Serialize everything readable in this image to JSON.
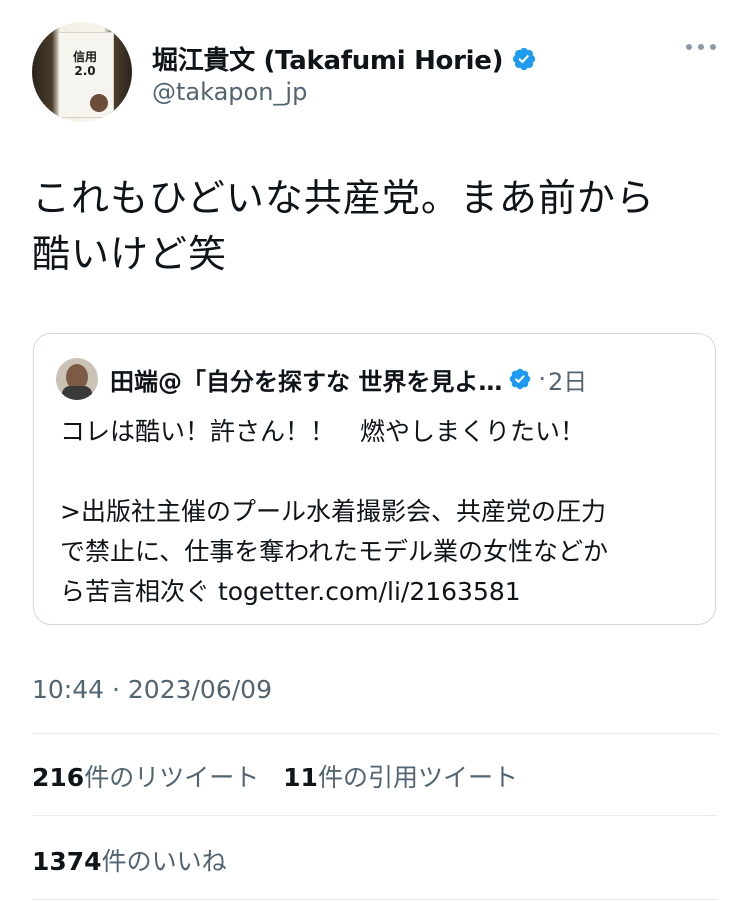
{
  "author": {
    "display_name": "堀江貴文 (Takafumi Horie)",
    "handle": "@takapon_jp",
    "avatar_book_title": "信用\n2.0"
  },
  "tweet": {
    "text": "これもひどいな共産党。まあ前から\n酷いけど笑"
  },
  "quoted_tweet": {
    "author_name": "田端@「自分を探すな 世界を見よ…",
    "separator": "·",
    "time": "2日",
    "text": "コレは酷い！許さん！！　燃やしまくりたい！\n\n>出版社主催のプール水着撮影会、共産党の圧力\nで禁止に、仕事を奪われたモデル業の女性などか\nら苦言相次ぐ togetter.com/li/2163581"
  },
  "meta": {
    "timestamp": "10:44 · 2023/06/09"
  },
  "stats": {
    "retweets_count": "216",
    "retweets_label": "件のリツイート",
    "quotes_count": "11",
    "quotes_label": "件の引用ツイート",
    "likes_count": "1374",
    "likes_label": "件のいいね"
  },
  "colors": {
    "verified_blue": "#1d9bf0",
    "secondary_text": "#536471",
    "border": "#cfd9de"
  },
  "icons": {
    "verified": "verified-badge-icon",
    "more": "more-options-icon"
  }
}
